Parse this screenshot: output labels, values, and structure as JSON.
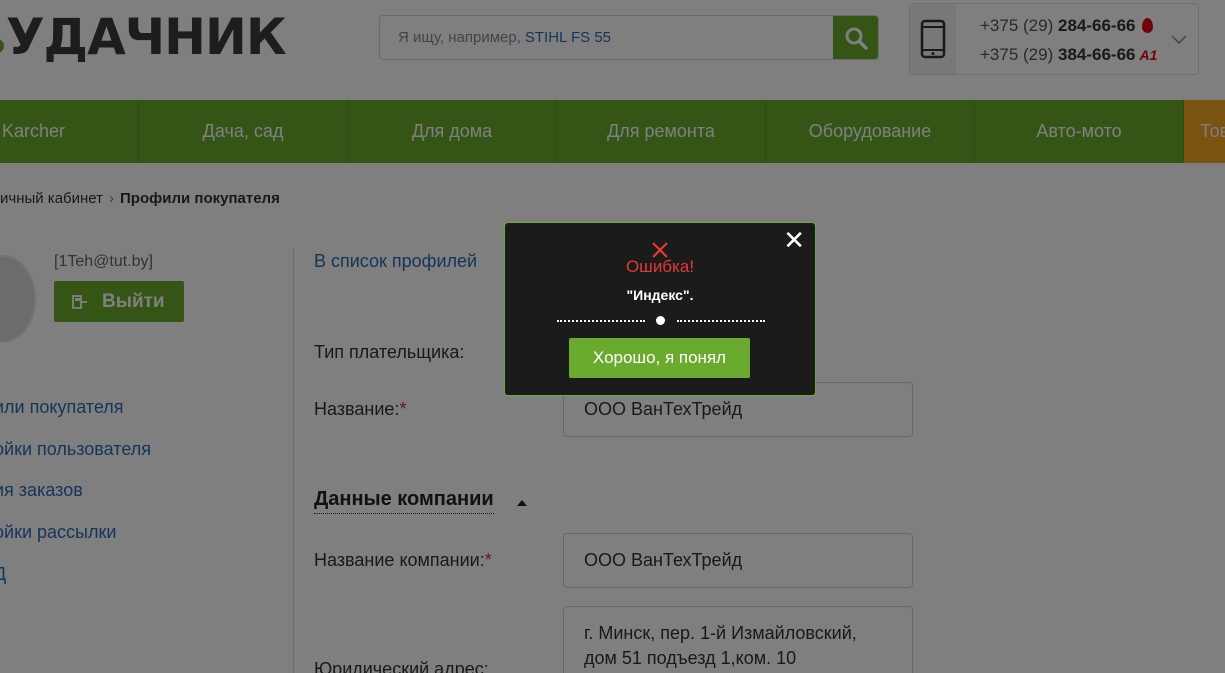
{
  "header": {
    "logo_text": "УДАЧНИК",
    "search_placeholder": "Я ищу, например,",
    "search_example": "STIHL FS 55",
    "phone1_prefix": "+375 (29) ",
    "phone1_number": "284-66-66",
    "phone2_prefix": "+375 (29) ",
    "phone2_number": "384-66-66",
    "operator2": "A1"
  },
  "nav": {
    "items": [
      "Karcher",
      "Дача, сад",
      "Для дома",
      "Для ремонта",
      "Оборудование",
      "Авто-мото",
      "Тов"
    ]
  },
  "breadcrumb": {
    "parent": "ичный кабинет",
    "current": "Профили покупателя"
  },
  "sidebar": {
    "email": "[1Teh@tut.by]",
    "logout": "Выйти",
    "links": [
      "или покупателя",
      "ойки пользователя",
      "ия заказов",
      "ойки рассылки",
      "Д"
    ]
  },
  "main": {
    "back_link": "В список профилей",
    "payer_type_label": "Тип плательщика:",
    "name_label": "Название:",
    "name_value": "ООО ВанТехТрейд",
    "section_company": "Данные компании",
    "company_name_label": "Название компании:",
    "company_name_value": "ООО ВанТехТрейд",
    "legal_address_label": "Юридический адрес:",
    "legal_address_line1": "г. Минск, пер. 1-й Измайловский,",
    "legal_address_line2": "дом 51 подъезд 1,ком. 10",
    "required_mark": "*"
  },
  "modal": {
    "title": "Ошибка!",
    "message": "\"Индекс\".",
    "ok_button": "Хорошо, я понял",
    "close": "✕"
  },
  "colors": {
    "brand_green": "#6aaa2e",
    "accent_orange": "#f5a623",
    "error_red": "#e53935",
    "link_blue": "#2b6cb0"
  }
}
